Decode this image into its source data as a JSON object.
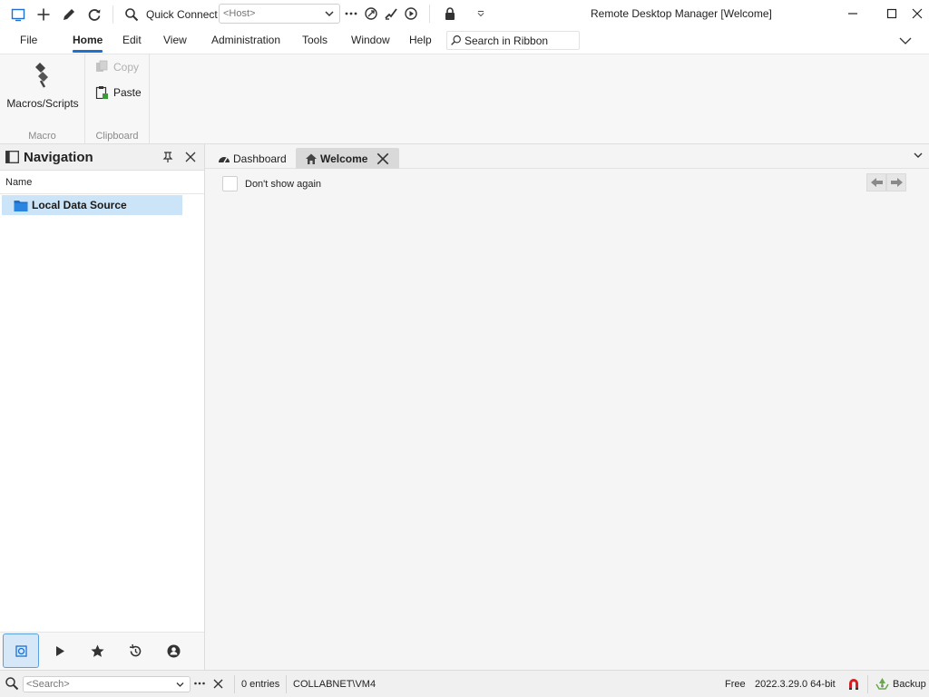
{
  "app": {
    "window_title": "Remote Desktop Manager [Welcome]"
  },
  "quick_access": {
    "quick_connect_label": "Quick Connect",
    "host_placeholder": "<Host>"
  },
  "menu": {
    "items": [
      "File",
      "Home",
      "Edit",
      "View",
      "Administration",
      "Tools",
      "Window",
      "Help"
    ],
    "active": "Home",
    "ribbon_search_label": "Search in Ribbon"
  },
  "ribbon": {
    "macro_group": {
      "caption": "Macro",
      "button": "Macros/Scripts"
    },
    "clipboard_group": {
      "caption": "Clipboard",
      "copy": "Copy",
      "paste": "Paste"
    }
  },
  "navigation": {
    "title": "Navigation",
    "column_header": "Name",
    "items": [
      {
        "label": "Local Data Source",
        "selected": true
      }
    ],
    "bottom_tabs": [
      "navigation-icon",
      "play-icon",
      "star-icon",
      "history-icon",
      "user-icon"
    ]
  },
  "document": {
    "tabs": [
      {
        "label": "Dashboard",
        "icon": "dashboard-icon",
        "active": false
      },
      {
        "label": "Welcome",
        "icon": "home-icon",
        "active": true
      }
    ],
    "dont_show_again_label": "Don't show again",
    "dont_show_again_checked": false
  },
  "statusbar": {
    "search_placeholder": "<Search>",
    "entries": "0 entries",
    "user": "COLLABNET\\VM4",
    "license": "Free",
    "version": "2022.3.29.0 64-bit",
    "backup_label": "Backup"
  },
  "colors": {
    "accent": "#1e6fd0",
    "selection": "#cce4f7",
    "folder": "#1f6fc5"
  }
}
